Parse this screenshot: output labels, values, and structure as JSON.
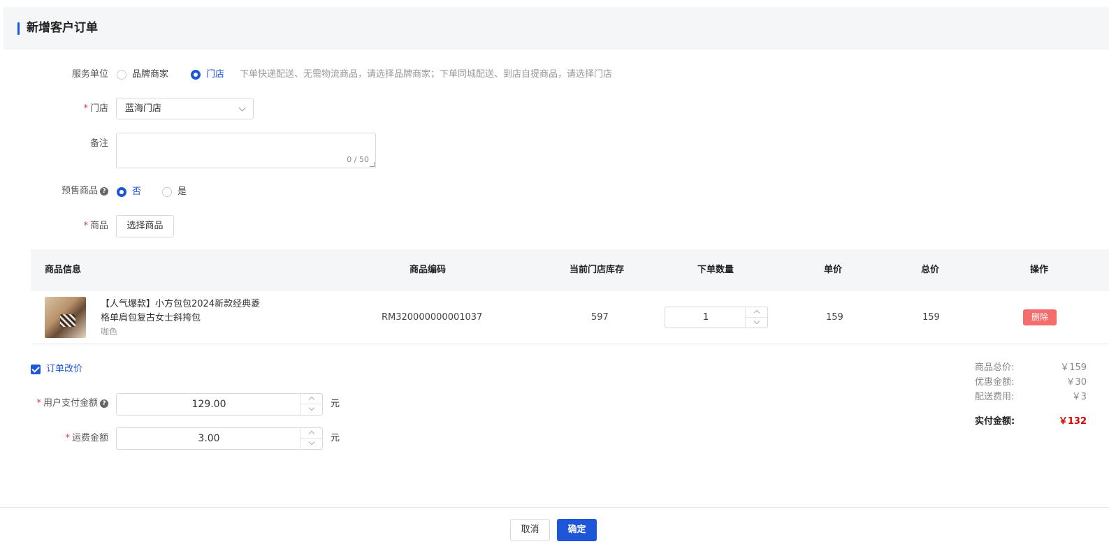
{
  "page": {
    "title": "新增客户订单"
  },
  "service_unit": {
    "label": "服务单位",
    "options": [
      "品牌商家",
      "门店"
    ],
    "selected": "门店",
    "hint": "下单快递配送、无需物流商品，请选择品牌商家；下单同城配送、到店自提商品，请选择门店"
  },
  "store": {
    "label": "门店",
    "value": "蓝海门店"
  },
  "remark": {
    "label": "备注",
    "value": "",
    "counter": "0 / 50"
  },
  "presale": {
    "label": "预售商品",
    "options": [
      "否",
      "是"
    ],
    "selected": "否"
  },
  "goods": {
    "label": "商品",
    "button": "选择商品"
  },
  "table": {
    "headers": [
      "商品信息",
      "商品编码",
      "当前门店库存",
      "下单数量",
      "单价",
      "总价",
      "操作"
    ],
    "rows": [
      {
        "name": "【人气爆款】小方包包2024新款经典菱格单肩包复古女士斜挎包",
        "variant": "咖色",
        "code": "RM320000000001037",
        "stock": "597",
        "qty": "1",
        "unit_price": "159",
        "total": "159",
        "action": "删除"
      }
    ]
  },
  "reprice": {
    "label": "订单改价",
    "checked": true
  },
  "user_pay": {
    "label": "用户支付金额",
    "value": "129.00",
    "unit": "元"
  },
  "shipping": {
    "label": "运费金额",
    "value": "3.00",
    "unit": "元"
  },
  "summary": {
    "goods_total_label": "商品总价:",
    "goods_total": "￥159",
    "discount_label": "优惠金额:",
    "discount": "￥30",
    "delivery_label": "配送费用:",
    "delivery": "￥3",
    "paid_label": "实付金额:",
    "paid": "￥132"
  },
  "footer": {
    "cancel": "取消",
    "confirm": "确定"
  },
  "colors": {
    "primary": "#1e56d8",
    "danger": "#f56c6c",
    "price": "#d40000"
  }
}
